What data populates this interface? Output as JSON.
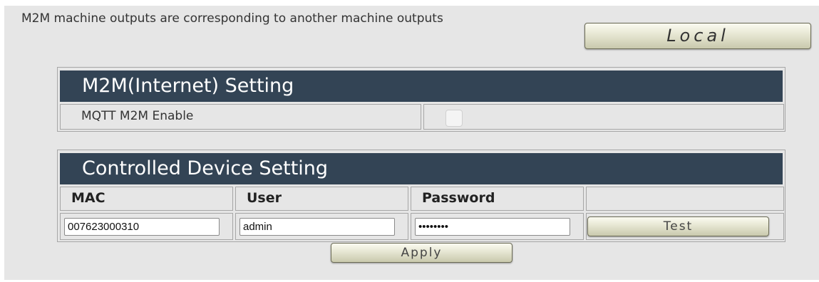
{
  "description": "M2M machine outputs are corresponding to another machine outputs",
  "local_button": "Local",
  "m2m_section": {
    "title": "M2M(Internet) Setting",
    "enable_label": "MQTT M2M Enable",
    "enable_checked": false
  },
  "device_section": {
    "title": "Controlled Device Setting",
    "columns": [
      "MAC",
      "User",
      "Password",
      ""
    ],
    "row": {
      "mac": "007623000310",
      "user": "admin",
      "password": "••••••••"
    },
    "test_button": "Test"
  },
  "apply_button": "Apply"
}
